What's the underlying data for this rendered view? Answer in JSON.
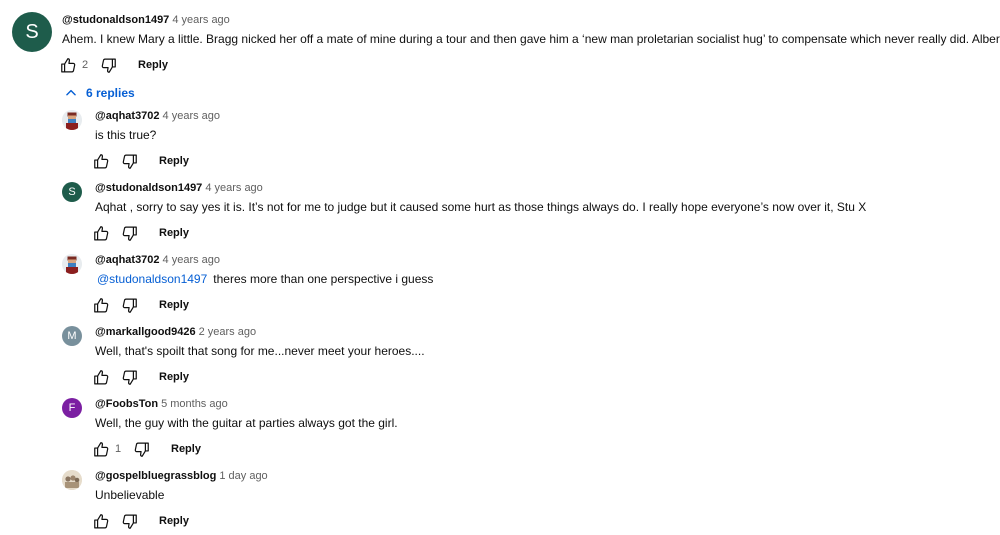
{
  "top_comment": {
    "avatar_letter": "S",
    "avatar_color": "#1e5c4b",
    "handle": "@studonaldson1497",
    "time": "4 years ago",
    "text": "Ahem. I knew Mary a little. Bragg nicked her off a mate of mine during a tour and then gave him a ‘new man proletarian socialist hug’ to compensate which never really did. Albert X",
    "likes": "2",
    "reply_label": "Reply"
  },
  "replies_toggle": {
    "label": "6 replies",
    "icon": "chevron-up-icon"
  },
  "replies": [
    {
      "avatar_type": "image",
      "avatar_desc": "person-with-mask-icon",
      "handle": "@aqhat3702",
      "time": "4 years ago",
      "mention": "",
      "text": "is this true?",
      "likes": "",
      "reply_label": "Reply"
    },
    {
      "avatar_type": "letter",
      "avatar_letter": "S",
      "avatar_color": "#1e5c4b",
      "handle": "@studonaldson1497",
      "time": "4 years ago",
      "mention": "",
      "text": "Aqhat , sorry to say yes it is. It’s not for me to judge but it caused some hurt as those things always do. I really hope everyone’s now over it, Stu X",
      "likes": "",
      "reply_label": "Reply"
    },
    {
      "avatar_type": "image",
      "avatar_desc": "person-with-mask-icon",
      "handle": "@aqhat3702",
      "time": "4 years ago",
      "mention": "@studonaldson1497",
      "text": "theres more than one perspective i guess",
      "likes": "",
      "reply_label": "Reply"
    },
    {
      "avatar_type": "letter",
      "avatar_letter": "M",
      "avatar_color": "#78909c",
      "handle": "@markallgood9426",
      "time": "2 years ago",
      "mention": "",
      "text": "Well, that's spoilt that song for me...never meet your heroes....",
      "likes": "",
      "reply_label": "Reply"
    },
    {
      "avatar_type": "letter",
      "avatar_letter": "F",
      "avatar_color": "#7b1fa2",
      "handle": "@FoobsTon",
      "time": "5 months ago",
      "mention": "",
      "text": "Well, the guy with the guitar at parties always got the girl.",
      "likes": "1",
      "reply_label": "Reply"
    },
    {
      "avatar_type": "image",
      "avatar_desc": "vintage-portrait-icon",
      "handle": "@gospelbluegrassblog",
      "time": "1 day ago",
      "mention": "",
      "text": "Unbelievable",
      "likes": "",
      "reply_label": "Reply"
    }
  ]
}
